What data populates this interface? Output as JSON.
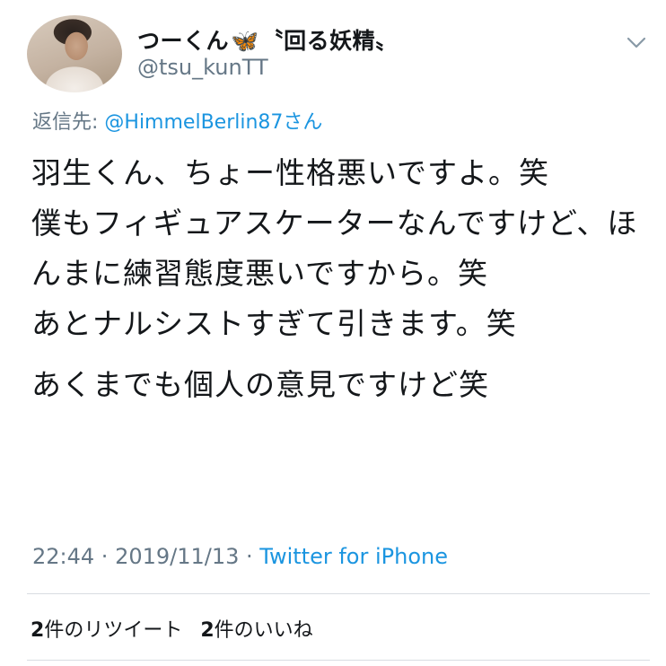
{
  "user": {
    "display_name": "つーくん",
    "display_name_emoji": "🦋",
    "display_name_suffix": "〝回る妖精〟",
    "handle": "@tsu_kunTT"
  },
  "reply": {
    "prefix": "返信先: ",
    "mention": "@HimmelBerlin87さん"
  },
  "tweet": {
    "lines": [
      "羽生くん、ちょー性格悪いですよ。笑",
      "僕もフィギュアスケーターなんですけど、ほんまに練習態度悪いですから。笑",
      "あとナルシストすぎて引きます。笑"
    ],
    "last_line": "あくまでも個人の意見ですけど笑"
  },
  "meta": {
    "time": "22:44",
    "separator": " · ",
    "date": "2019/11/13",
    "source": "Twitter for iPhone"
  },
  "stats": {
    "retweets_count": "2",
    "retweets_label": "件のリツイート",
    "likes_count": "2",
    "likes_label": "件のいいね"
  },
  "icons": {
    "menu": "chevron-down-icon"
  }
}
